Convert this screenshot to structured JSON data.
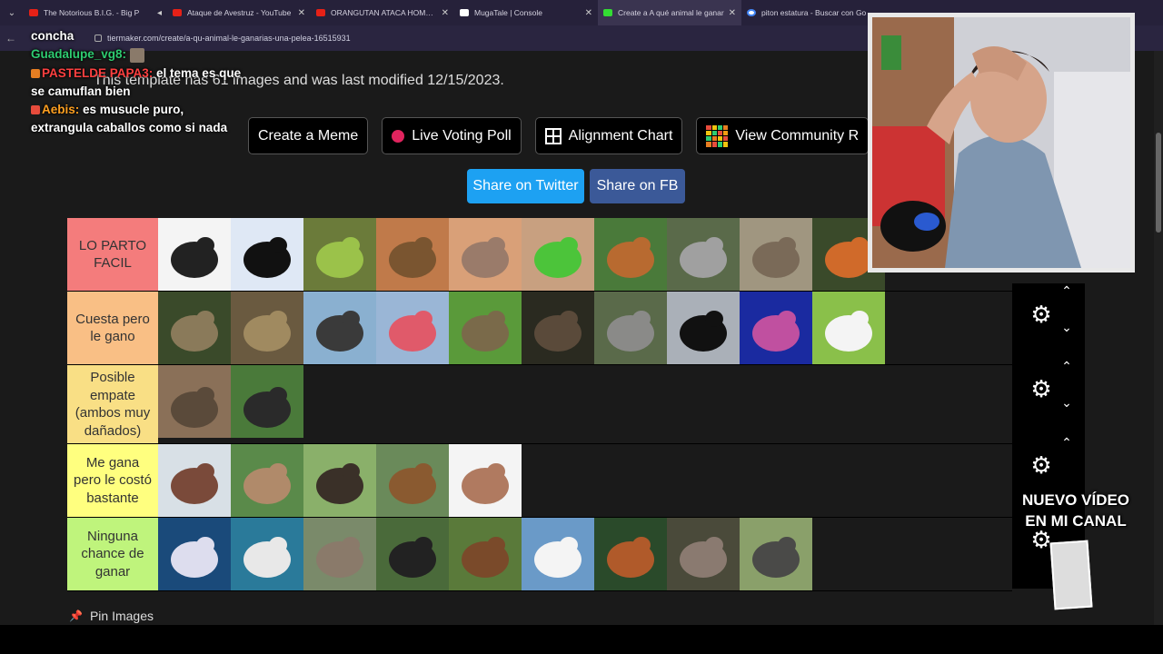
{
  "browser": {
    "tabs": [
      {
        "title": "The Notorious B.I.G. - Big P",
        "icon": "youtube-icon"
      },
      {
        "title": "Ataque de Avestruz - YouTube",
        "icon": "youtube-icon"
      },
      {
        "title": "ORANGUTAN ATACA HOMBRE",
        "icon": "youtube-icon"
      },
      {
        "title": "MugaTale | Console",
        "icon": "mugatale-icon"
      },
      {
        "title": "Create a A qué animal le ganar",
        "icon": "tiermaker-icon"
      },
      {
        "title": "piton estatura - Buscar con Go",
        "icon": "google-icon"
      }
    ],
    "url": "tiermaker.com/create/a-qu-animal-le-ganarias-una-pelea-16515931"
  },
  "page": {
    "template_info": "This template has 61 images and was last modified 12/15/2023.",
    "buttons": {
      "create_meme": "Create a Meme",
      "live_voting": "Live Voting Poll",
      "alignment": "Alignment Chart",
      "community": "View Community R"
    },
    "share_twitter": "Share on Twitter",
    "share_fb": "Share on FB",
    "pin_images": "Pin Images"
  },
  "tiers": [
    {
      "label": "LO PARTO FACIL",
      "color": "#f47c7c",
      "items": [
        "scorpion",
        "penguin",
        "chameleon",
        "meerkat",
        "armadillo",
        "parrot",
        "squirrel",
        "koala",
        "seal",
        "fox"
      ]
    },
    {
      "label": "Cuesta pero le gano",
      "color": "#f9bf85",
      "items": [
        "sloth",
        "hyena",
        "ostrich",
        "flamingo",
        "tortoise",
        "turtle",
        "rhino-grey",
        "crow",
        "octopus",
        "cow"
      ]
    },
    {
      "label": "Posible empate (ambos muy dañados)",
      "color": "#f9df85",
      "items": [
        "python",
        "anteater"
      ]
    },
    {
      "label": "Me gana pero le costó bastante",
      "color": "#ffff7f",
      "items": [
        "walrus",
        "kangaroo",
        "buffalo",
        "deer",
        "pitbull"
      ]
    },
    {
      "label": "Ninguna chance de ganar",
      "color": "#bff47c",
      "items": [
        "whale",
        "shark",
        "elephant",
        "gorilla",
        "bear",
        "polar-bear",
        "orangutan",
        "hippo",
        "rhino"
      ]
    }
  ],
  "chat": [
    {
      "user": "",
      "text": "concha"
    },
    {
      "user": "Guadalupe_vg8:",
      "text": "",
      "color": "green"
    },
    {
      "user": "PASTELDE PAPA3:",
      "text": "el tema es que se camuflan bien",
      "color": "red"
    },
    {
      "user": "Aebis:",
      "text": "es musucle puro, extrangula caballos como si nada",
      "color": "orange"
    }
  ],
  "overlay": {
    "promo": "NUEVO VÍDEO EN MI CANAL"
  }
}
